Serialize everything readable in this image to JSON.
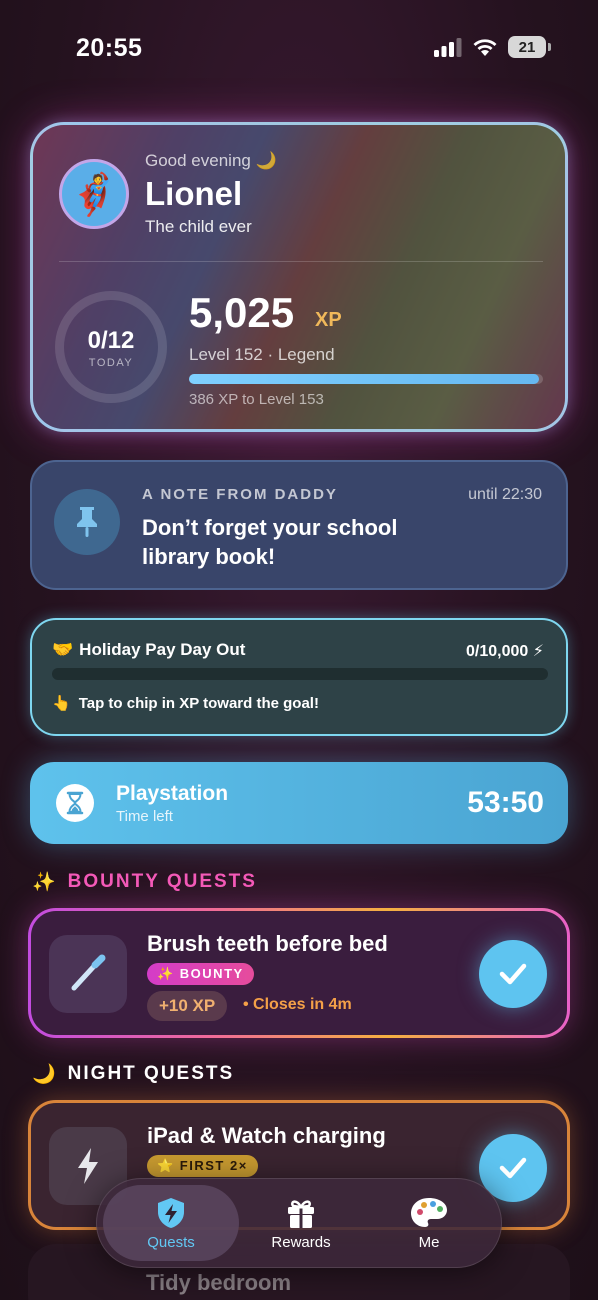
{
  "status_bar": {
    "time": "20:55",
    "battery": "21"
  },
  "profile": {
    "avatar_emoji": "🦸",
    "greeting": "Good evening 🌙",
    "name": "Lionel",
    "tagline": "The child ever",
    "today_count": "0/12",
    "today_label": "TODAY",
    "xp_value": "5,025",
    "xp_unit": "XP",
    "level_text": "Level 152 · Legend",
    "level_progress_fraction": 0.99,
    "next_level_text": "386 XP to Level 153"
  },
  "note": {
    "label": "A NOTE FROM DADDY",
    "until": "until 22:30",
    "text": "Don’t forget your school library book!"
  },
  "holiday": {
    "title": "Holiday Pay Day Out",
    "progress": "0/10,000 ⚡",
    "progress_fraction": 0,
    "hint": "Tap to chip in XP toward the goal!"
  },
  "playstation": {
    "title": "Playstation",
    "subtitle": "Time left",
    "timer": "53:50"
  },
  "bounty_section": {
    "header": "BOUNTY QUESTS",
    "quest": {
      "title": "Brush teeth before bed",
      "badge": "✨ BOUNTY",
      "xp": "+10 XP",
      "closes": "• Closes in 4m"
    }
  },
  "night_section": {
    "header": "NIGHT QUESTS",
    "quest": {
      "title": "iPad & Watch charging",
      "badge": "⭐ FIRST 2×"
    },
    "next_quest_title": "Tidy bedroom"
  },
  "tabs": [
    {
      "label": "Quests",
      "icon": "shield-bolt-icon"
    },
    {
      "label": "Rewards",
      "icon": "gift-icon"
    },
    {
      "label": "Me",
      "icon": "palette-icon"
    }
  ],
  "colors": {
    "accent_blue": "#5ec4f0",
    "bounty_pink": "#f45ab8",
    "xp_gold": "#f0b85a",
    "closes_orange": "#f4a048"
  }
}
